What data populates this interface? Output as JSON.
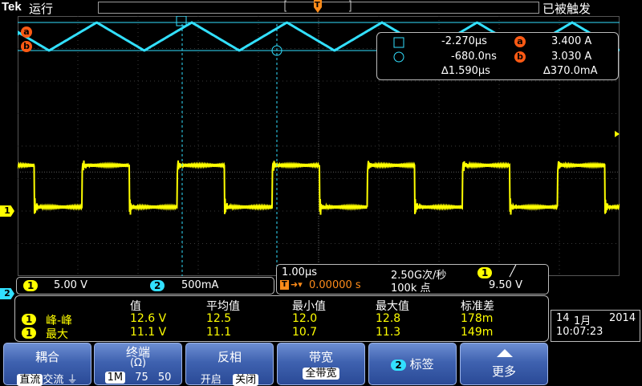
{
  "topbar": {
    "brand": "Tek",
    "run_state": "运行",
    "trigger_state": "已被触发",
    "trigger_marker": "T"
  },
  "cursors": {
    "a_label": "a",
    "b_label": "b",
    "t1_time": "-2.270μs",
    "t2_time": "-680.0ns",
    "delta_time": "∆1.590μs",
    "a_value": "3.400 A",
    "b_value": "3.030 A",
    "delta_value": "∆370.0mA"
  },
  "channels": {
    "ch1_label": "1",
    "ch1_scale": "5.00 V",
    "ch2_label": "2",
    "ch2_scale": "500mA"
  },
  "timebase": {
    "horizontal_scale": "1.00μs",
    "sample_rate": "2.50G次/秒",
    "trigger_source": "1",
    "trigger_slope": "╱",
    "trigger_position": "0.00000 s",
    "record_length": "100k 点",
    "trigger_level": "9.50 V"
  },
  "measurements": {
    "headers": [
      "值",
      "平均值",
      "最小值",
      "最大值",
      "标准差"
    ],
    "rows": [
      {
        "source": "1",
        "name": "峰-峰",
        "value": "12.6 V",
        "mean": "12.5",
        "min": "12.0",
        "max": "12.8",
        "std": "178m"
      },
      {
        "source": "1",
        "name": "最大",
        "value": "11.1 V",
        "mean": "11.1",
        "min": "10.7",
        "max": "11.3",
        "std": "149m"
      }
    ]
  },
  "clock": {
    "date_day": "14",
    "date_month": "1月",
    "date_year": "2014",
    "time": "10:07:23"
  },
  "softkeys": {
    "coupling": {
      "title": "耦合",
      "options": [
        "直流",
        "交流",
        "⏚"
      ]
    },
    "termination": {
      "title": "终端",
      "subtitle": "(Ω)",
      "options": [
        "1M",
        "75",
        "50"
      ]
    },
    "invert": {
      "title": "反相",
      "options": [
        "开启",
        "关闭"
      ]
    },
    "bandwidth": {
      "title": "带宽",
      "value": "全带宽"
    },
    "label": {
      "channel": "2",
      "title": "标签"
    },
    "more": {
      "title": "更多"
    }
  },
  "colors": {
    "ch1": "#ffff00",
    "ch2": "#32e0ff",
    "cursor": "#ff5a14",
    "softkey": "#3f62b0"
  }
}
